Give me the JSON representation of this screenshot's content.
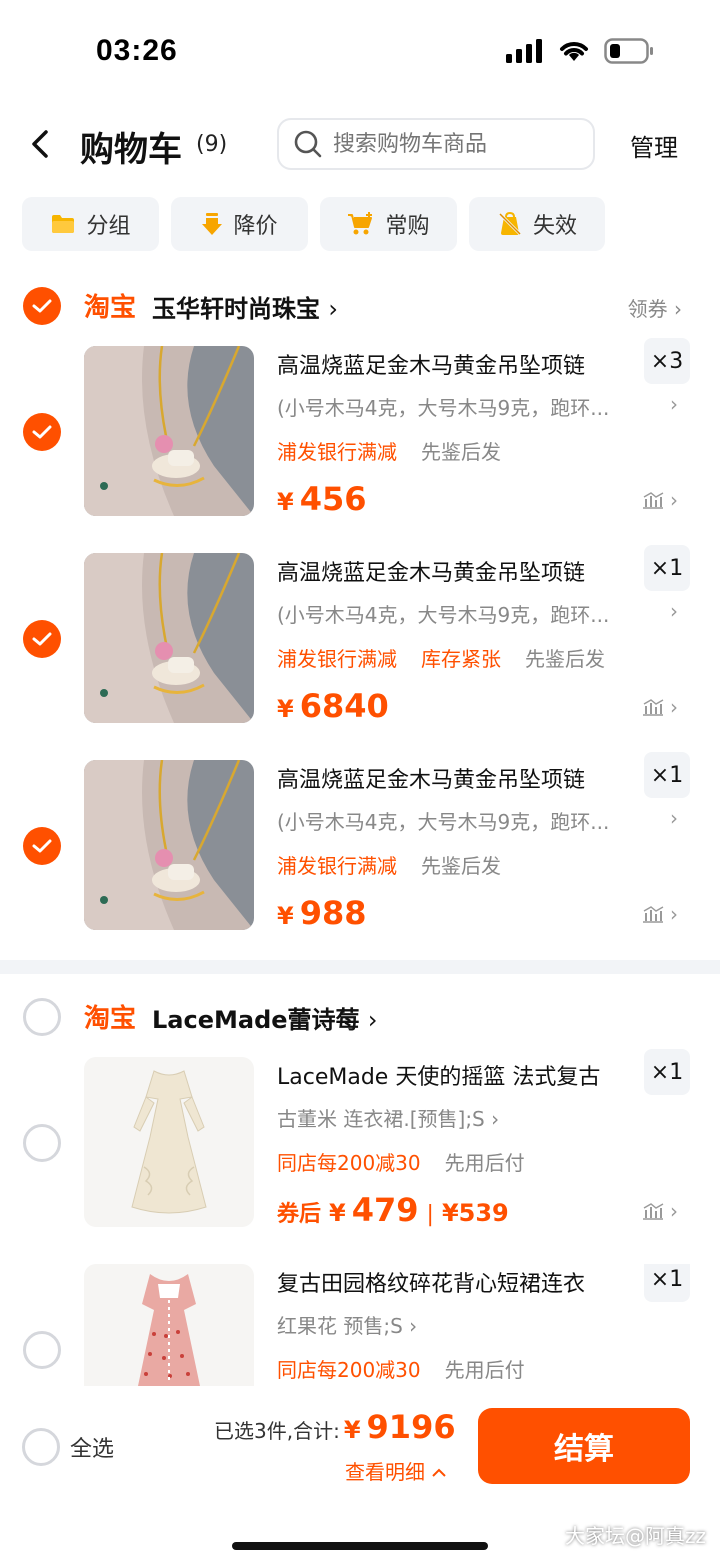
{
  "status": {
    "time": "03:26"
  },
  "header": {
    "title": "购物车",
    "count": "(9)",
    "search_placeholder": "搜索购物车商品",
    "manage": "管理"
  },
  "filters": [
    {
      "label": "分组",
      "icon": "folder-icon"
    },
    {
      "label": "降价",
      "icon": "price-down-icon"
    },
    {
      "label": "常购",
      "icon": "cart-icon"
    },
    {
      "label": "失效",
      "icon": "invalid-icon"
    }
  ],
  "shops": [
    {
      "platform": "淘宝",
      "name": "玉华轩时尚珠宝",
      "coupon": "领券",
      "checked": true,
      "items": [
        {
          "title": "高温烧蓝足金木马黄金吊坠项链",
          "qty": "×3",
          "spec": "(小号木马4克，大号木马9克，跑环...",
          "tags": [
            {
              "text": "浦发银行满减",
              "style": "orange"
            },
            {
              "text": "先鉴后发",
              "style": "grey"
            }
          ],
          "price_prefix": "",
          "price": "456",
          "price_orig": ""
        },
        {
          "title": "高温烧蓝足金木马黄金吊坠项链",
          "qty": "×1",
          "spec": "(小号木马4克，大号木马9克，跑环...",
          "tags": [
            {
              "text": "浦发银行满减",
              "style": "orange"
            },
            {
              "text": "库存紧张",
              "style": "orange"
            },
            {
              "text": "先鉴后发",
              "style": "grey"
            }
          ],
          "price_prefix": "",
          "price": "6840",
          "price_orig": ""
        },
        {
          "title": "高温烧蓝足金木马黄金吊坠项链",
          "qty": "×1",
          "spec": "(小号木马4克，大号木马9克，跑环...",
          "tags": [
            {
              "text": "浦发银行满减",
              "style": "orange"
            },
            {
              "text": "先鉴后发",
              "style": "grey"
            }
          ],
          "price_prefix": "",
          "price": "988",
          "price_orig": ""
        }
      ]
    },
    {
      "platform": "淘宝",
      "name": "LaceMade蕾诗莓",
      "coupon": "",
      "checked": false,
      "items": [
        {
          "title": "LaceMade 天使的摇篮 法式复古",
          "qty": "×1",
          "spec": "古董米 连衣裙.[预售];S",
          "tags": [
            {
              "text": "同店每200减30",
              "style": "orange"
            },
            {
              "text": "先用后付",
              "style": "grey"
            }
          ],
          "price_prefix": "券后",
          "price": "479",
          "price_orig": "¥539"
        },
        {
          "title": "复古田园格纹碎花背心短裙连衣",
          "qty": "×1",
          "spec": "红果花 预售;S",
          "tags": [
            {
              "text": "同店每200减30",
              "style": "orange"
            },
            {
              "text": "先用后付",
              "style": "grey"
            }
          ],
          "price_prefix": "",
          "price": "",
          "price_orig": ""
        }
      ]
    }
  ],
  "bottom": {
    "select_all": "全选",
    "selected_text": "已选3件,合计:",
    "yen": "¥",
    "total": "9196",
    "detail": "查看明细",
    "checkout": "结算"
  },
  "watermark": "大家坛@阿真zz",
  "colors": {
    "accent": "#ff5000",
    "muted": "#888888",
    "chip_bg": "#f2f4f7"
  }
}
